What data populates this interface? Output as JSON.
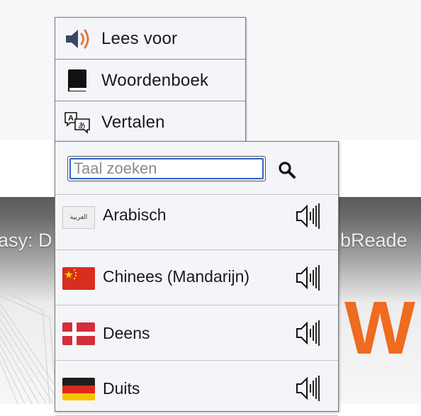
{
  "background": {
    "video_title_left": "asy: D",
    "video_title_right": "bReade",
    "video_big_letter": "W"
  },
  "menu": {
    "items": [
      {
        "label": "Lees voor",
        "icon": "speaker-icon"
      },
      {
        "label": "Woordenboek",
        "icon": "book-icon"
      },
      {
        "label": "Vertalen",
        "icon": "translate-icon"
      }
    ]
  },
  "language_panel": {
    "search": {
      "placeholder": "Taal zoeken",
      "value": "",
      "icon": "search-icon"
    },
    "languages": [
      {
        "name": "Arabisch",
        "flag": "arabic-flag-icon",
        "flag_text": "العربية",
        "audio_icon": "audio-speaker-icon"
      },
      {
        "name": "Chinees (Mandarijn)",
        "flag": "china-flag-icon",
        "audio_icon": "audio-speaker-icon"
      },
      {
        "name": "Deens",
        "flag": "denmark-flag-icon",
        "audio_icon": "audio-speaker-icon"
      },
      {
        "name": "Duits",
        "flag": "germany-flag-icon",
        "audio_icon": "audio-speaker-icon"
      }
    ]
  },
  "colors": {
    "menu_bg": "#f4f5f9",
    "menu_border": "#76777b",
    "search_focus": "#2f64c8",
    "accent_orange": "#ee6b1f",
    "speaker_wave": "#e07a45"
  }
}
